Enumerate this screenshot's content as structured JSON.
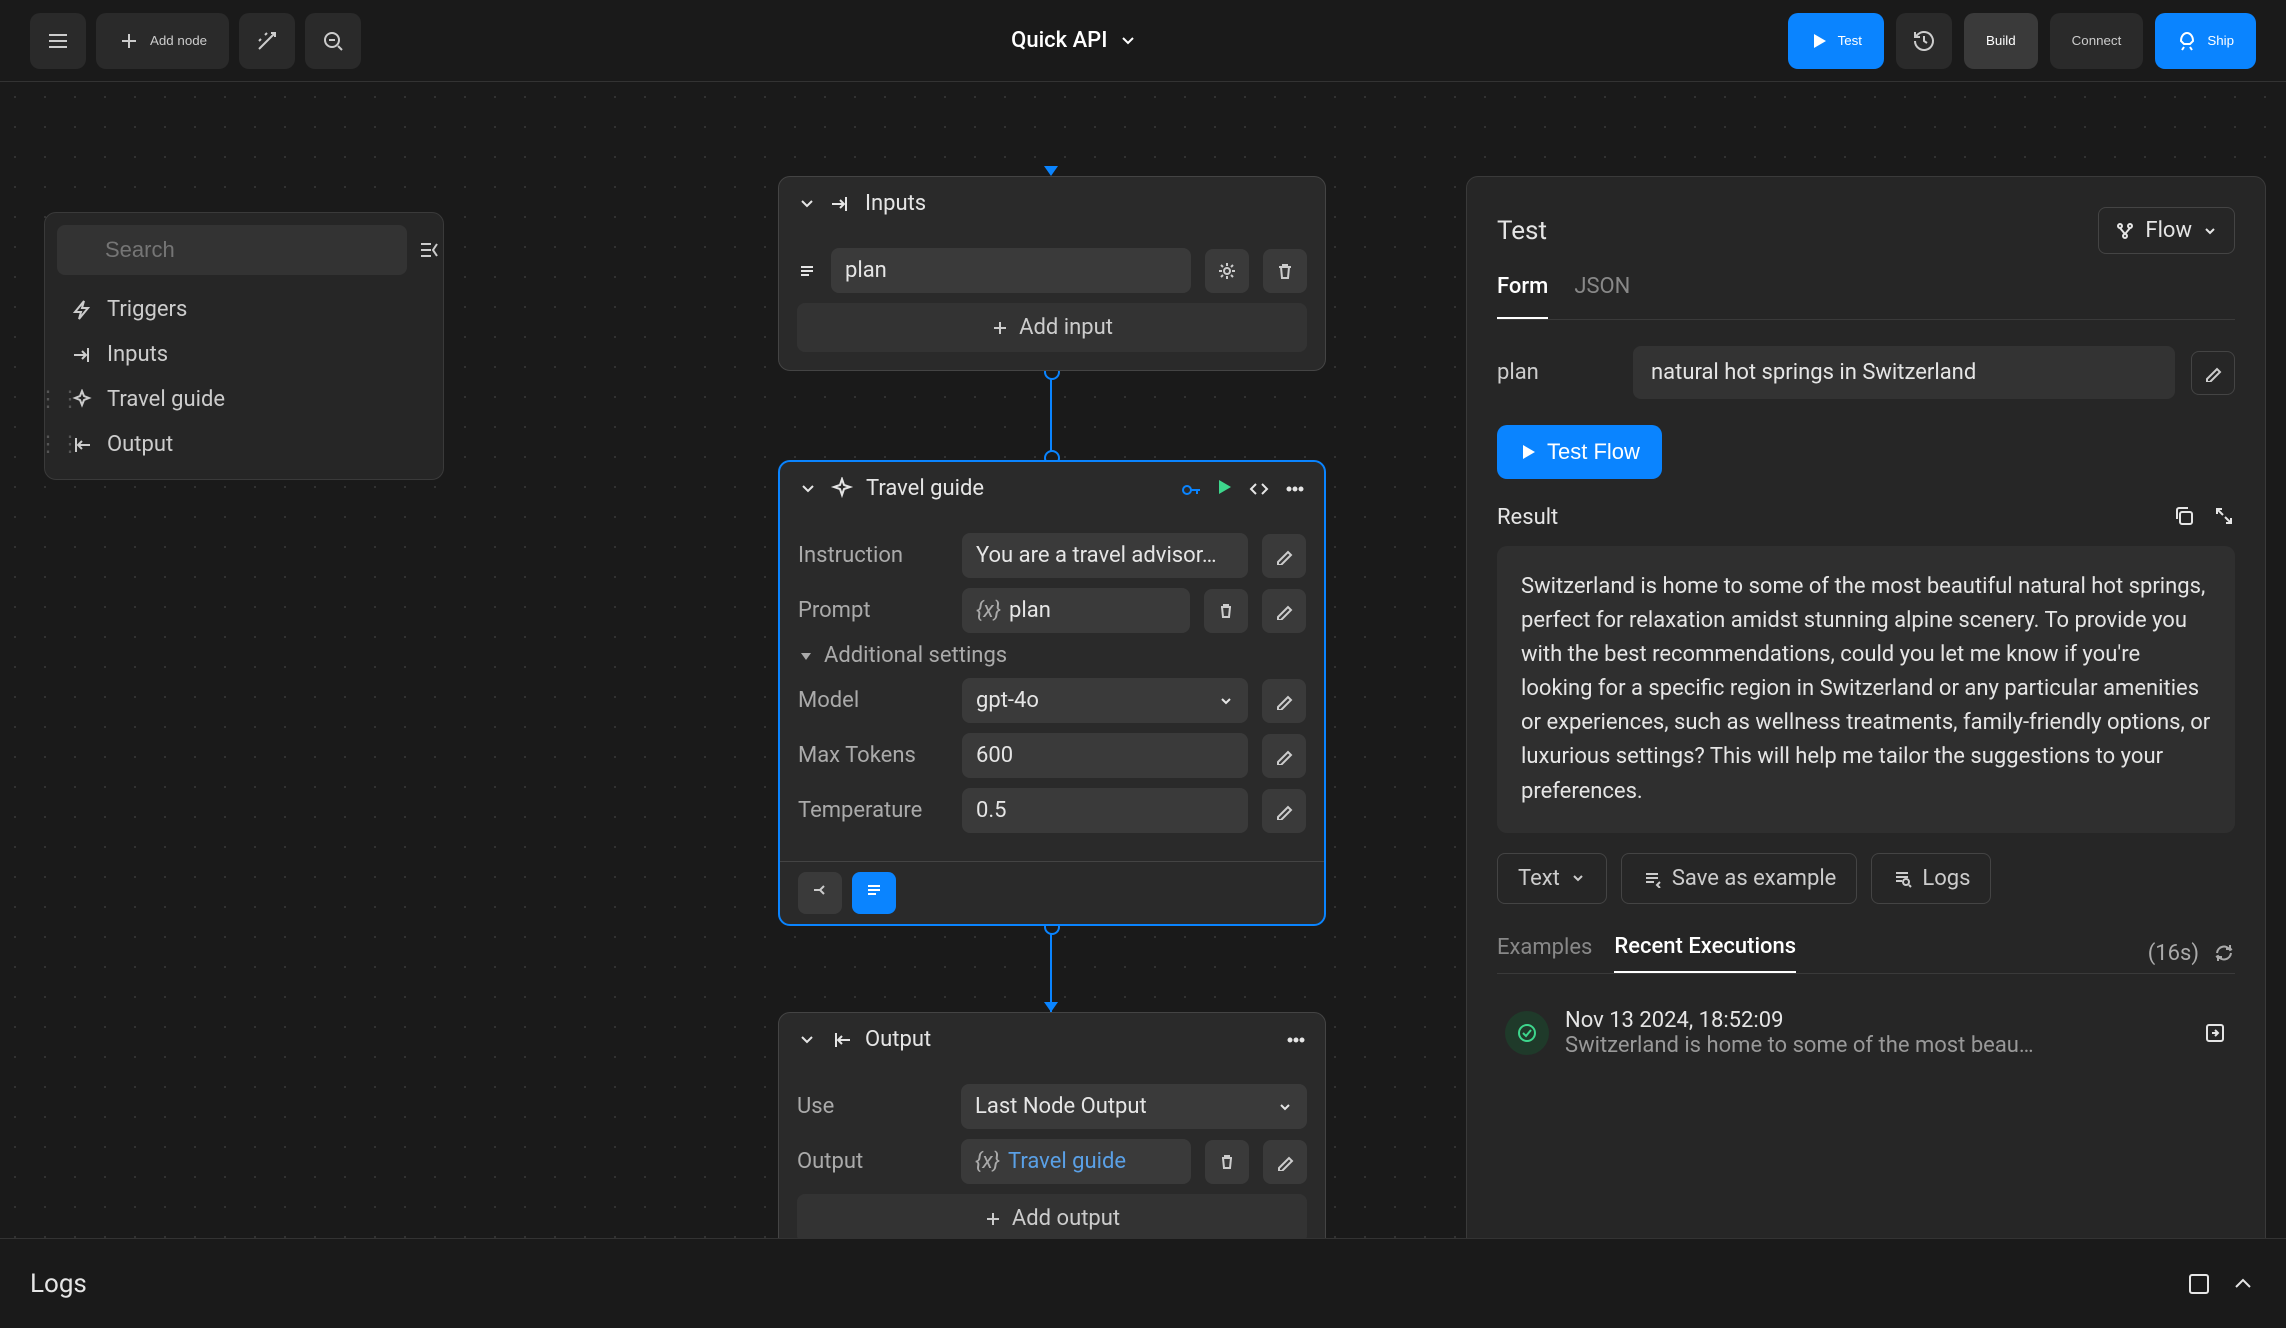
{
  "topbar": {
    "add_node": "Add node",
    "title": "Quick API",
    "test": "Test",
    "build": "Build",
    "connect": "Connect",
    "ship": "Ship"
  },
  "sidebar": {
    "search_placeholder": "Search",
    "items": [
      {
        "label": "Triggers",
        "icon": "bolt"
      },
      {
        "label": "Inputs",
        "icon": "arrow-in"
      },
      {
        "label": "Travel guide",
        "icon": "sparkle"
      },
      {
        "label": "Output",
        "icon": "arrow-out"
      }
    ]
  },
  "nodes": {
    "inputs": {
      "title": "Inputs",
      "input_name": "plan",
      "add_input": "Add input"
    },
    "travel": {
      "title": "Travel guide",
      "instruction_label": "Instruction",
      "instruction_value": "You are a travel advisor…",
      "prompt_label": "Prompt",
      "prompt_value": "plan",
      "additional": "Additional settings",
      "model_label": "Model",
      "model_value": "gpt-4o",
      "max_tokens_label": "Max Tokens",
      "max_tokens_value": "600",
      "temperature_label": "Temperature",
      "temperature_value": "0.5"
    },
    "output": {
      "title": "Output",
      "use_label": "Use",
      "use_value": "Last Node Output",
      "output_label": "Output",
      "output_value": "Travel guide",
      "add_output": "Add output"
    }
  },
  "panel": {
    "title": "Test",
    "flow": "Flow",
    "tabs": {
      "form": "Form",
      "json": "JSON"
    },
    "plan_label": "plan",
    "plan_value": "natural hot springs in Switzerland",
    "test_flow": "Test Flow",
    "result_label": "Result",
    "result_text": "Switzerland is home to some of the most beautiful natural hot springs, perfect for relaxation amidst stunning alpine scenery. To provide you with the best recommendations, could you let me know if you're looking for a specific region in Switzerland or any particular amenities or experiences, such as wellness treatments, family-friendly options, or luxurious settings? This will help me tailor the suggestions to your preferences.",
    "text_btn": "Text",
    "save_example": "Save as example",
    "logs": "Logs",
    "exec_tabs": {
      "examples": "Examples",
      "recent": "Recent Executions"
    },
    "duration": "(16s)",
    "exec": {
      "time": "Nov 13 2024, 18:52:09",
      "preview": "Switzerland is home to some of the most beau…"
    }
  },
  "logs_bar": {
    "label": "Logs"
  }
}
